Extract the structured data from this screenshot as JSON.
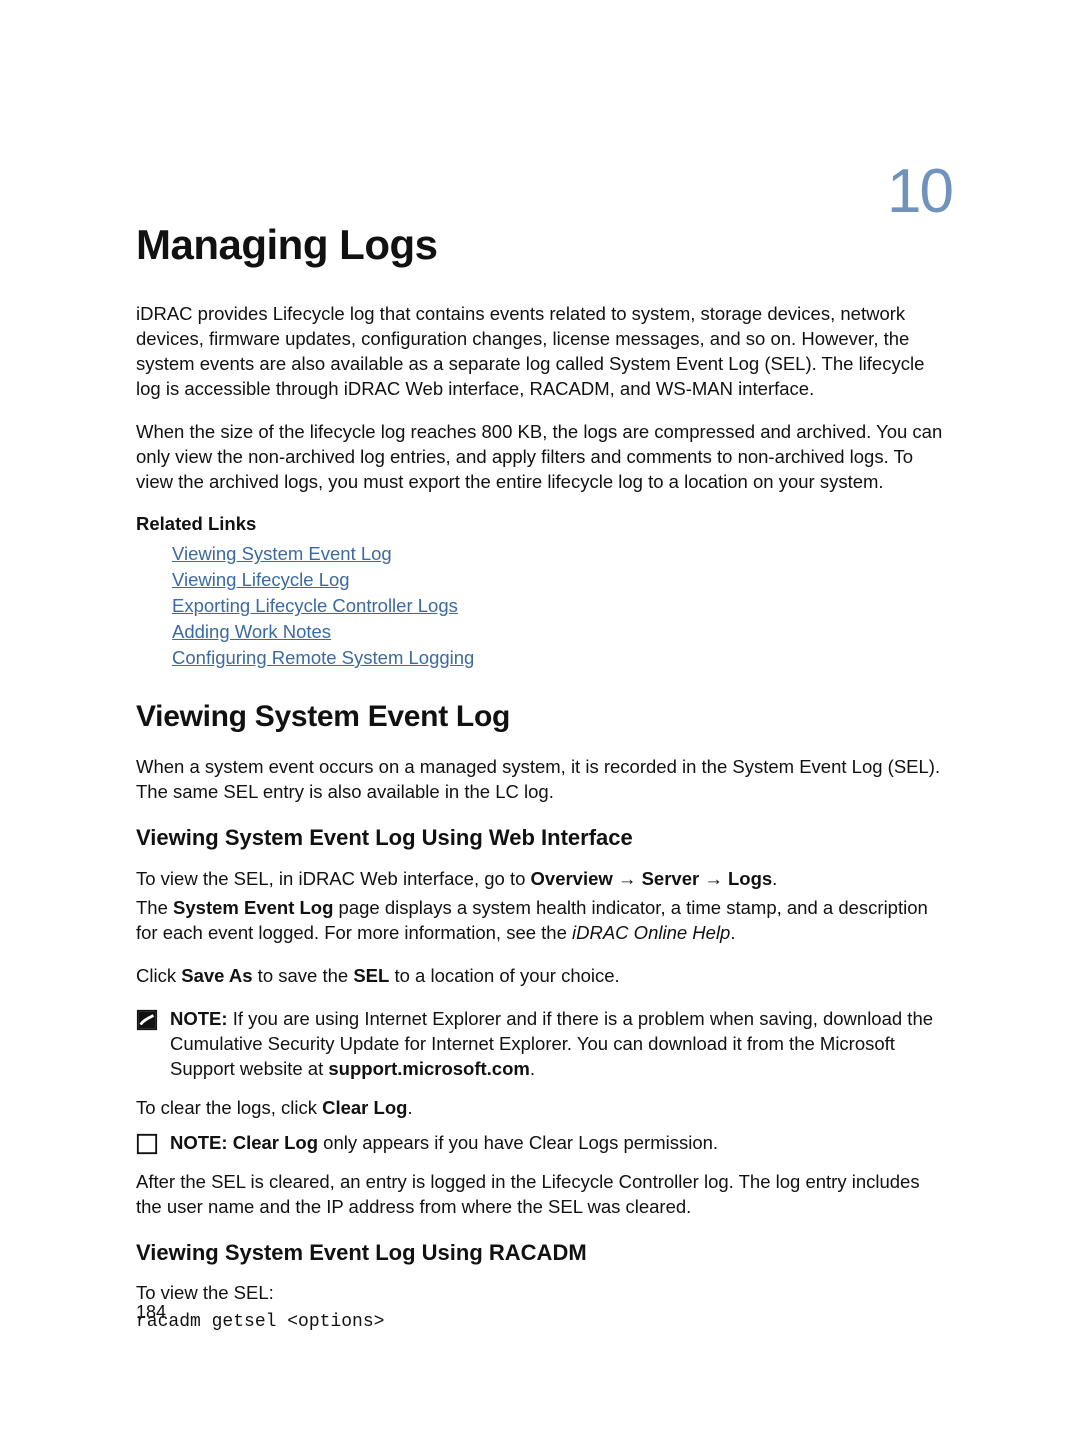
{
  "chapter_number": "10",
  "title": "Managing Logs",
  "intro_p1": "iDRAC provides Lifecycle log that contains events related to system, storage devices, network devices, firmware updates, configuration changes, license messages, and so on. However, the system events are also available as a separate log called System Event Log (SEL). The lifecycle log is accessible through iDRAC Web interface, RACADM, and WS-MAN interface.",
  "intro_p2": "When the size of the lifecycle log reaches 800 KB, the logs are compressed and archived. You can only view the non-archived log entries, and apply filters and comments to non-archived logs. To view the archived logs, you must export the entire lifecycle log to a location on your system.",
  "related_links_heading": "Related Links",
  "related_links": [
    "Viewing System Event Log",
    "Viewing Lifecycle Log",
    "Exporting Lifecycle Controller Logs",
    "Adding Work Notes",
    "Configuring Remote System Logging"
  ],
  "section1": {
    "heading": "Viewing System Event Log",
    "para": "When a system event occurs on a managed system, it is recorded in the System Event Log (SEL). The same SEL entry is also available in the LC log."
  },
  "sub1": {
    "heading": "Viewing System Event Log Using Web Interface",
    "p1_pre": "To view the SEL, in iDRAC Web interface, go to ",
    "p1_b1": "Overview",
    "p1_arrow1": " → ",
    "p1_b2": "Server",
    "p1_arrow2": " → ",
    "p1_b3": "Logs",
    "p1_post": ".",
    "p2_pre": "The ",
    "p2_b1": "System Event Log",
    "p2_mid": " page displays a system health indicator, a time stamp, and a description for each event logged. For more information, see the ",
    "p2_em": "iDRAC Online Help",
    "p2_post": ".",
    "p3_pre": "Click ",
    "p3_b1": "Save As",
    "p3_mid": " to save the ",
    "p3_b2": "SEL",
    "p3_post": " to a location of your choice.",
    "note1_label": "NOTE: ",
    "note1_text": "If you are using Internet Explorer and if there is a problem when saving, download the Cumulative Security Update for Internet Explorer. You can download it from the Microsoft Support website at ",
    "note1_bold": "support.microsoft.com",
    "note1_post": ".",
    "p4_pre": "To clear the logs, click ",
    "p4_b1": "Clear Log",
    "p4_post": ".",
    "note2_label": "NOTE: ",
    "note2_b1": "Clear Log",
    "note2_text": " only appears if you have Clear Logs permission.",
    "p5": "After the SEL is cleared, an entry is logged in the Lifecycle Controller log. The log entry includes the user name and the IP address from where the SEL was cleared."
  },
  "sub2": {
    "heading": "Viewing System Event Log Using RACADM",
    "p1": "To view the SEL:",
    "code": "racadm getsel <options>"
  },
  "page_number": "184"
}
